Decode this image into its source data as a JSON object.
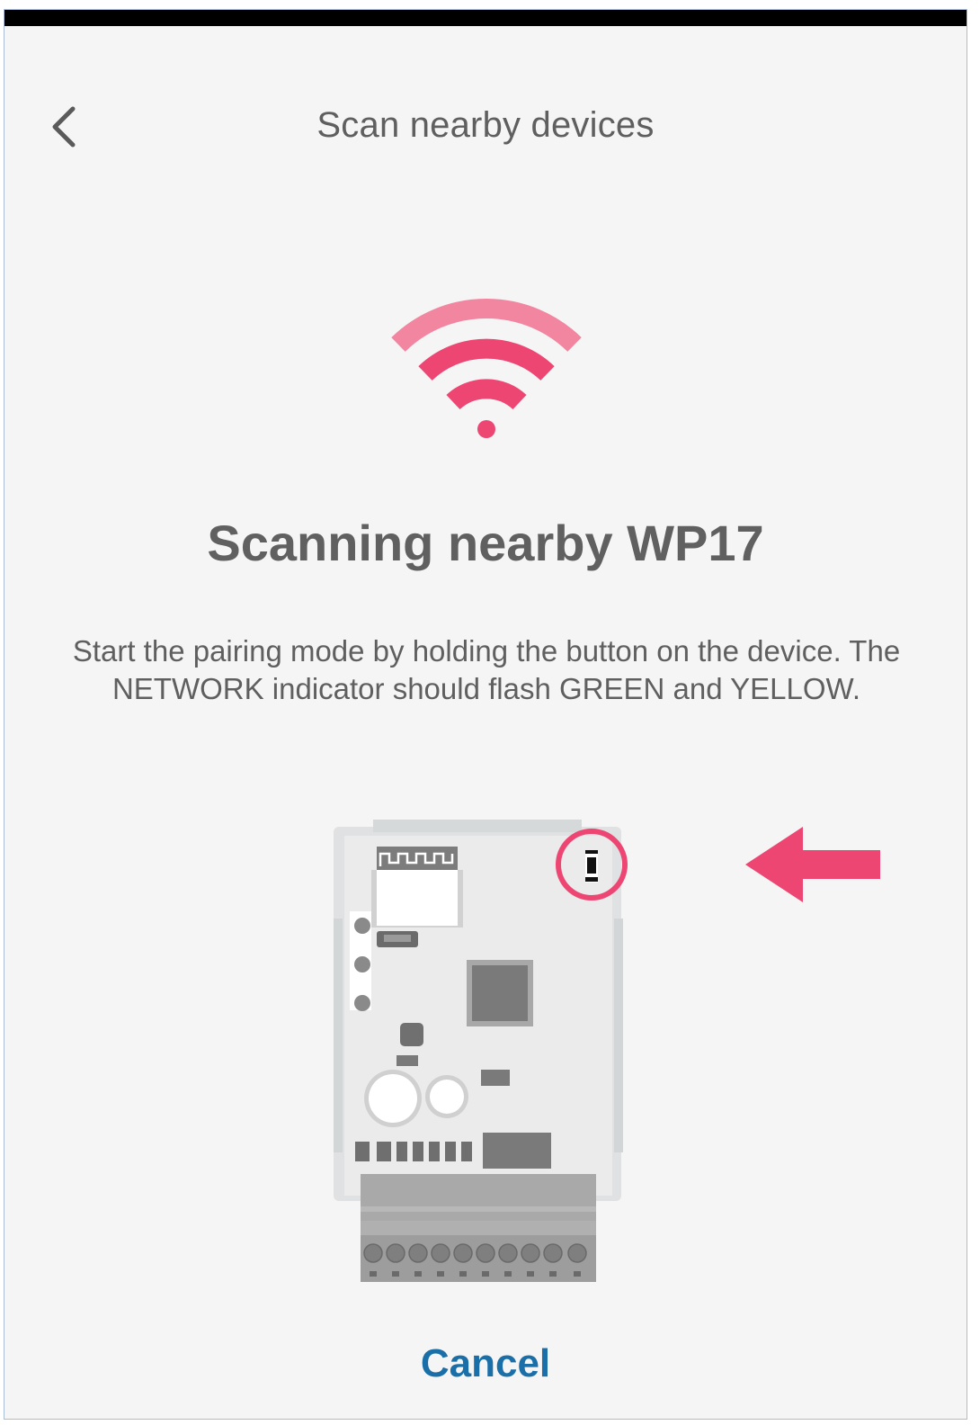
{
  "header": {
    "title": "Scan nearby devices",
    "back_icon": "chevron-left-icon"
  },
  "main": {
    "wifi_icon": "wifi-icon",
    "heading": "Scanning nearby WP17",
    "instructions": "Start the pairing mode by holding the button on the device. The NETWORK indicator should flash GREEN and YELLOW.",
    "device_image": "wp17-circuit-board",
    "arrow_icon": "arrow-left-icon"
  },
  "footer": {
    "cancel_label": "Cancel"
  },
  "colors": {
    "accent": "#ee4672",
    "accent_light": "#f2859f",
    "link": "#1a6fa8",
    "background": "#f5f5f5",
    "text": "#5f5f5f"
  }
}
